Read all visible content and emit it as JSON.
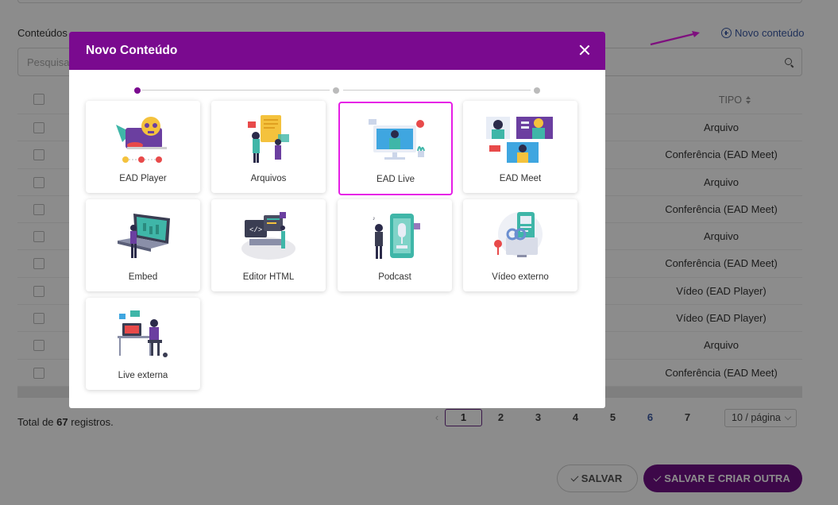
{
  "page": {
    "section_title": "Conteúdos",
    "new_link": "Novo conteúdo",
    "search_placeholder": "Pesquisar",
    "type_header": "TIPO",
    "rows": [
      "Arquivo",
      "Conferência (EAD Meet)",
      "Arquivo",
      "Conferência (EAD Meet)",
      "Arquivo",
      "Conferência (EAD Meet)",
      "Vídeo (EAD Player)",
      "Vídeo (EAD Player)",
      "Arquivo",
      "Conferência (EAD Meet)"
    ],
    "total_prefix": "Total de",
    "total_count": "67",
    "total_suffix": "registros.",
    "pages": [
      "1",
      "2",
      "3",
      "4",
      "5",
      "6",
      "7"
    ],
    "current_page": "1",
    "per_page": "10 / página",
    "save_label": "SALVAR",
    "save_more_label": "SALVAR E CRIAR OUTRA"
  },
  "modal": {
    "title": "Novo Conteúdo",
    "steps": 3,
    "active_step": 1,
    "cards": [
      {
        "label": "EAD Player",
        "icon": "skull-player-icon"
      },
      {
        "label": "Arquivos",
        "icon": "files-icon"
      },
      {
        "label": "EAD Live",
        "icon": "live-stream-icon",
        "selected": true
      },
      {
        "label": "EAD Meet",
        "icon": "video-meeting-icon"
      },
      {
        "label": "Embed",
        "icon": "laptop-embed-icon"
      },
      {
        "label": "Editor HTML",
        "icon": "html-editor-icon"
      },
      {
        "label": "Podcast",
        "icon": "podcast-microphone-icon"
      },
      {
        "label": "Vídeo externo",
        "icon": "external-video-icon"
      },
      {
        "label": "Live externa",
        "icon": "external-live-icon"
      }
    ]
  },
  "colors": {
    "brand_purple": "#7a0a8f",
    "button_purple": "#6f0f86",
    "selection_magenta": "#e61ee6",
    "link_blue": "#3b5aa5"
  }
}
